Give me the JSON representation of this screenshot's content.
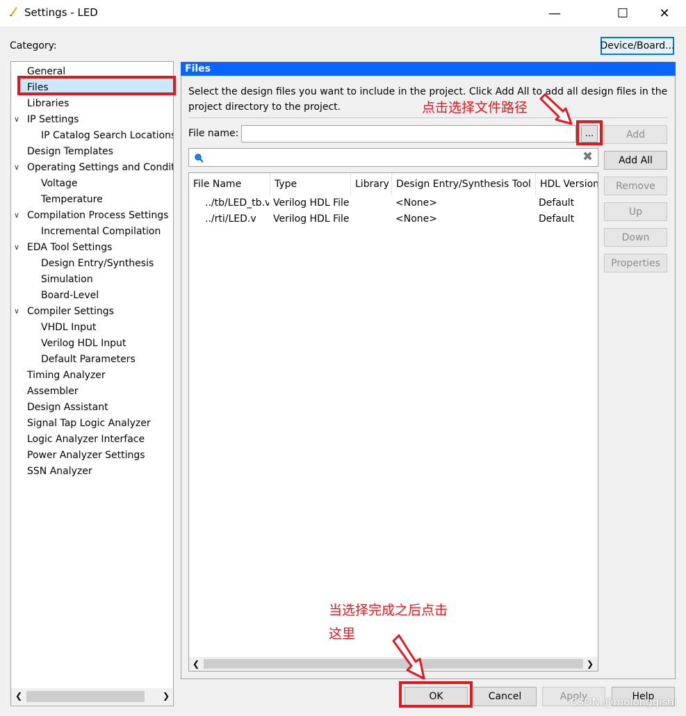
{
  "window": {
    "title": "Settings - LED",
    "controls": {
      "minimize": "—",
      "maximize": "☐",
      "close": "✕"
    }
  },
  "category_label": "Category:",
  "device_button": "Device/Board...",
  "tree": [
    {
      "label": "General",
      "level": 0
    },
    {
      "label": "Files",
      "level": 0,
      "selected": true
    },
    {
      "label": "Libraries",
      "level": 0
    },
    {
      "label": "IP Settings",
      "level": 0,
      "expanded": true
    },
    {
      "label": "IP Catalog Search Locations",
      "level": 1
    },
    {
      "label": "Design Templates",
      "level": 0
    },
    {
      "label": "Operating Settings and Conditions",
      "level": 0,
      "expanded": true
    },
    {
      "label": "Voltage",
      "level": 1
    },
    {
      "label": "Temperature",
      "level": 1
    },
    {
      "label": "Compilation Process Settings",
      "level": 0,
      "expanded": true
    },
    {
      "label": "Incremental Compilation",
      "level": 1
    },
    {
      "label": "EDA Tool Settings",
      "level": 0,
      "expanded": true
    },
    {
      "label": "Design Entry/Synthesis",
      "level": 1
    },
    {
      "label": "Simulation",
      "level": 1
    },
    {
      "label": "Board-Level",
      "level": 1
    },
    {
      "label": "Compiler Settings",
      "level": 0,
      "expanded": true
    },
    {
      "label": "VHDL Input",
      "level": 1
    },
    {
      "label": "Verilog HDL Input",
      "level": 1
    },
    {
      "label": "Default Parameters",
      "level": 1
    },
    {
      "label": "Timing Analyzer",
      "level": 0
    },
    {
      "label": "Assembler",
      "level": 0
    },
    {
      "label": "Design Assistant",
      "level": 0
    },
    {
      "label": "Signal Tap Logic Analyzer",
      "level": 0
    },
    {
      "label": "Logic Analyzer Interface",
      "level": 0
    },
    {
      "label": "Power Analyzer Settings",
      "level": 0
    },
    {
      "label": "SSN Analyzer",
      "level": 0
    }
  ],
  "files": {
    "header": "Files",
    "description": "Select the design files you want to include in the project. Click Add All to add all design files in the project directory to the project.",
    "file_name_label": "File name:",
    "file_name_value": "",
    "browse_label": "...",
    "buttons": {
      "add": "Add",
      "add_all": "Add All",
      "remove": "Remove",
      "up": "Up",
      "down": "Down",
      "properties": "Properties"
    },
    "columns": [
      "File Name",
      "Type",
      "Library",
      "Design Entry/Synthesis Tool",
      "HDL Version"
    ],
    "rows": [
      [
        "../tb/LED_tb.v",
        "Verilog HDL File",
        "",
        "<None>",
        "Default"
      ],
      [
        "../rti/LED.v",
        "Verilog HDL File",
        "",
        "<None>",
        "Default"
      ]
    ]
  },
  "bottom_buttons": {
    "ok": "OK",
    "cancel": "Cancel",
    "apply": "Apply",
    "help": "Help"
  },
  "annotations": {
    "browse_hint": "点击选择文件路径",
    "ok_hint_line1": "当选择完成之后点击",
    "ok_hint_line2": "这里"
  },
  "watermark": "CSDN @molongqishi",
  "colors": {
    "accent": "#0a64fe",
    "annotation": "#e0181f",
    "selection": "#cce8ff"
  }
}
